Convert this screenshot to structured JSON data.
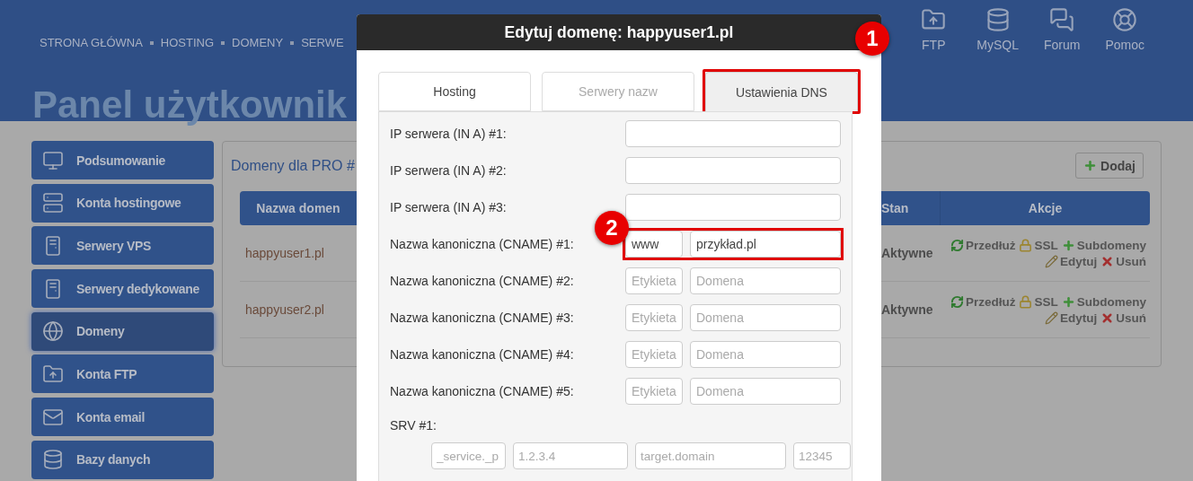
{
  "header": {
    "nav": [
      "STRONA GŁÓWNA",
      "HOSTING",
      "DOMENY",
      "SERWE"
    ],
    "quick_links": [
      {
        "kind": "ftp",
        "label": "FTP"
      },
      {
        "kind": "mysql",
        "label": "MySQL"
      },
      {
        "kind": "forum",
        "label": "Forum"
      },
      {
        "kind": "help",
        "label": "Pomoc"
      }
    ],
    "title": "Panel użytkownik"
  },
  "sidebar": {
    "items": [
      {
        "kind": "monitor",
        "label": "Podsumowanie",
        "selected": false
      },
      {
        "kind": "servers",
        "label": "Konta hostingowe",
        "selected": false
      },
      {
        "kind": "tower",
        "label": "Serwery VPS",
        "selected": false
      },
      {
        "kind": "tower",
        "label": "Serwery dedykowane",
        "selected": false
      },
      {
        "kind": "globe",
        "label": "Domeny",
        "selected": true
      },
      {
        "kind": "ftp",
        "label": "Konta FTP",
        "selected": false
      },
      {
        "kind": "mail",
        "label": "Konta email",
        "selected": false
      },
      {
        "kind": "database",
        "label": "Bazy danych",
        "selected": false
      }
    ]
  },
  "panel": {
    "title": "Domeny dla PRO #",
    "add_button": "Dodaj",
    "columns": [
      "Nazwa domen",
      "Stan",
      "Akcje"
    ],
    "rows": [
      {
        "domain": "happyuser1.pl",
        "status": "Aktywne",
        "actions": [
          {
            "kind": "renew",
            "label": "Przedłuż"
          },
          {
            "kind": "ssl",
            "label": "SSL"
          },
          {
            "kind": "add",
            "label": "Subdomeny"
          },
          {
            "kind": "edit",
            "label": "Edytuj"
          },
          {
            "kind": "delete",
            "label": "Usuń"
          }
        ]
      },
      {
        "domain": "happyuser2.pl",
        "status": "Aktywne",
        "actions": [
          {
            "kind": "renew",
            "label": "Przedłuż"
          },
          {
            "kind": "ssl",
            "label": "SSL"
          },
          {
            "kind": "add",
            "label": "Subdomeny"
          },
          {
            "kind": "edit",
            "label": "Edytuj"
          },
          {
            "kind": "delete",
            "label": "Usuń"
          }
        ]
      }
    ]
  },
  "modal": {
    "title": "Edytuj domenę: happyuser1.pl",
    "badge": "1",
    "tabs": [
      {
        "label": "Hosting",
        "selected": false,
        "disabled": false,
        "highlighted": false
      },
      {
        "label": "Serwery nazw",
        "selected": false,
        "disabled": true,
        "highlighted": false
      },
      {
        "label": "Ustawienia DNS",
        "selected": true,
        "disabled": false,
        "highlighted": true
      }
    ],
    "fields": [
      {
        "kind": "single",
        "label": "IP serwera (IN A) #1:"
      },
      {
        "kind": "single",
        "label": "IP serwera (IN A) #2:"
      },
      {
        "kind": "single",
        "label": "IP serwera (IN A) #3:"
      },
      {
        "kind": "cname",
        "label": "Nazwa kanoniczna (CNAME) #1:",
        "highlighted": true,
        "badge": "2",
        "inputs": [
          {
            "value": "www"
          },
          {
            "value": "przykład.pl"
          }
        ]
      },
      {
        "kind": "cname",
        "label": "Nazwa kanoniczna (CNAME) #2:",
        "highlighted": false,
        "inputs": [
          {
            "placeholder": "Etykieta"
          },
          {
            "placeholder": "Domena"
          }
        ]
      },
      {
        "kind": "cname",
        "label": "Nazwa kanoniczna (CNAME) #3:",
        "highlighted": false,
        "inputs": [
          {
            "placeholder": "Etykieta"
          },
          {
            "placeholder": "Domena"
          }
        ]
      },
      {
        "kind": "cname",
        "label": "Nazwa kanoniczna (CNAME) #4:",
        "highlighted": false,
        "inputs": [
          {
            "placeholder": "Etykieta"
          },
          {
            "placeholder": "Domena"
          }
        ]
      },
      {
        "kind": "cname",
        "label": "Nazwa kanoniczna (CNAME) #5:",
        "highlighted": false,
        "inputs": [
          {
            "placeholder": "Etykieta"
          },
          {
            "placeholder": "Domena"
          }
        ]
      }
    ],
    "srv": {
      "label": "SRV #1:",
      "inputs": [
        {
          "placeholder": "_service._p"
        },
        {
          "placeholder": "1.2.3.4"
        },
        {
          "placeholder": "target.domain"
        },
        {
          "placeholder": "12345"
        }
      ]
    }
  }
}
